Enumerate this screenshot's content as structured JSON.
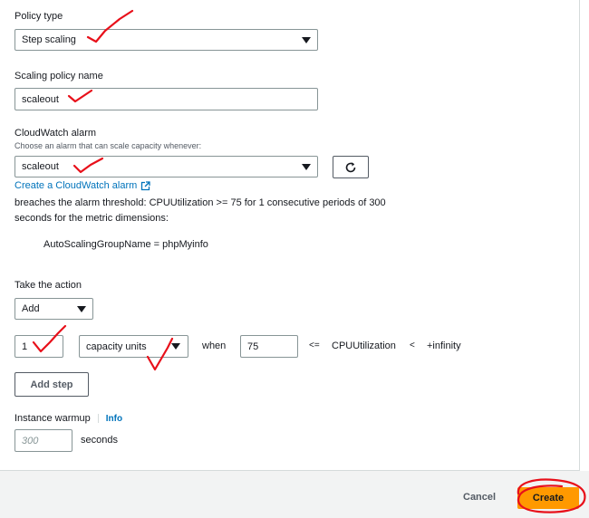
{
  "policy_type": {
    "label": "Policy type",
    "value": "Step scaling"
  },
  "policy_name": {
    "label": "Scaling policy name",
    "value": "scaleout"
  },
  "cloudwatch": {
    "label": "CloudWatch alarm",
    "description": "Choose an alarm that can scale capacity whenever:",
    "value": "scaleout",
    "refresh_icon": "refresh-icon",
    "create_link": "Create a CloudWatch alarm",
    "external_icon": "external-link-icon",
    "breach_line1": "breaches the alarm threshold: CPUUtilization >= 75 for 1 consecutive periods of 300",
    "breach_line2": "seconds for the metric dimensions:",
    "dimension": "AutoScalingGroupName = phpMyinfo"
  },
  "action": {
    "label": "Take the action",
    "action_value": "Add",
    "amount": "1",
    "unit_value": "capacity units",
    "when_label": "when",
    "lower_bound": "75",
    "lte": "<=",
    "metric": "CPUUtilization",
    "lt": "<",
    "upper_bound": "+infinity",
    "add_step": "Add step"
  },
  "warmup": {
    "label": "Instance warmup",
    "info": "Info",
    "placeholder": "300",
    "unit": "seconds"
  },
  "footer": {
    "cancel": "Cancel",
    "create": "Create",
    "create_color": "#ff9900"
  },
  "colors": {
    "annotation": "#e8101a",
    "link": "#0073bb"
  }
}
